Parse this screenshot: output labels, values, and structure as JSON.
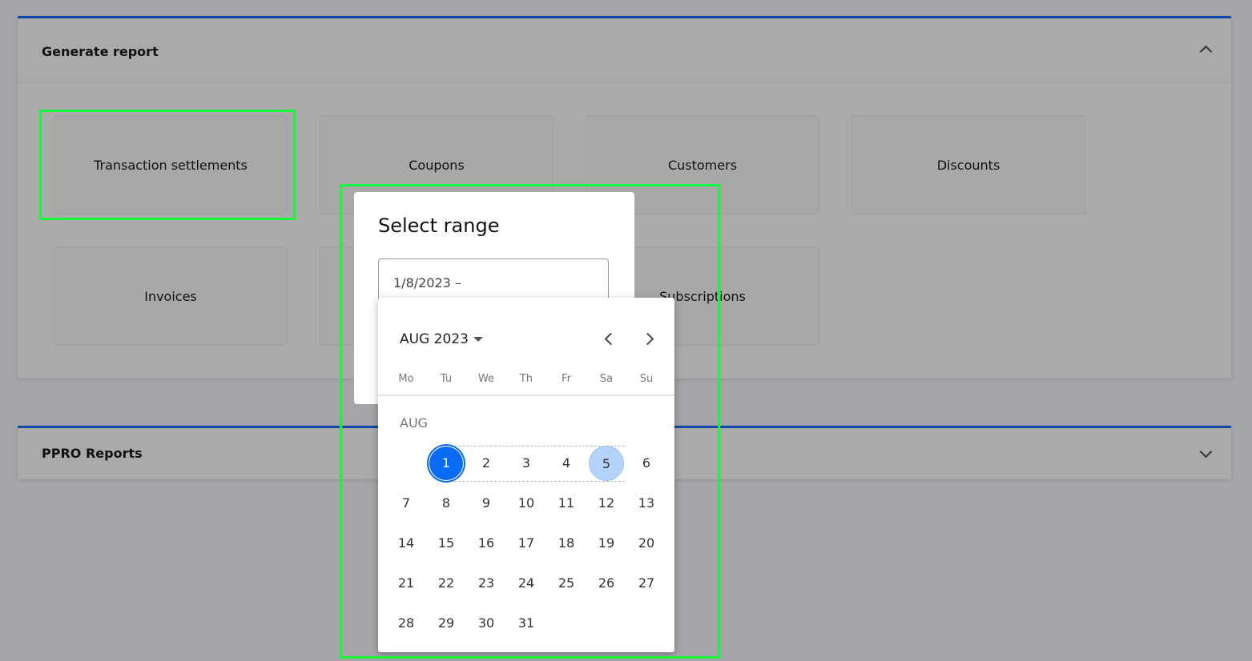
{
  "generate_report": {
    "title": "Generate report",
    "cards": [
      "Transaction settlements",
      "Coupons",
      "Customers",
      "Discounts",
      "Invoices",
      "",
      "Subscriptions"
    ]
  },
  "ppro_reports": {
    "title": "PPRO Reports"
  },
  "dialog": {
    "title": "Select range",
    "input_value": "1/8/2023 –"
  },
  "calendar": {
    "month_year": "AUG 2023",
    "month_label": "AUG",
    "weekdays": [
      "Mo",
      "Tu",
      "We",
      "Th",
      "Fr",
      "Sa",
      "Su"
    ],
    "days": [
      "1",
      "2",
      "3",
      "4",
      "5",
      "6",
      "7",
      "8",
      "9",
      "10",
      "11",
      "12",
      "13",
      "14",
      "15",
      "16",
      "17",
      "18",
      "19",
      "20",
      "21",
      "22",
      "23",
      "24",
      "25",
      "26",
      "27",
      "28",
      "29",
      "30",
      "31"
    ],
    "first_weekday_index": 1,
    "range_start": 1,
    "range_end": 5
  },
  "colors": {
    "accent": "#0a6cf5",
    "range_end": "#b3d3fb",
    "highlight": "#18f53c"
  }
}
